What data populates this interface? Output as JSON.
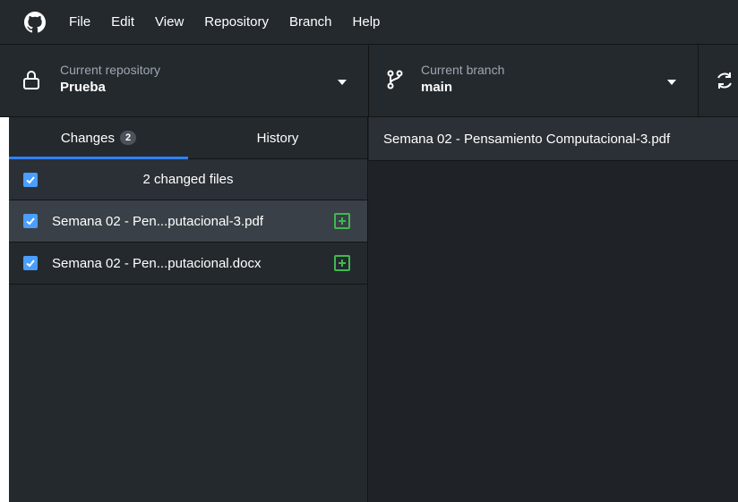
{
  "menubar": {
    "logo_icon": "github-icon",
    "items": [
      "File",
      "Edit",
      "View",
      "Repository",
      "Branch",
      "Help"
    ]
  },
  "toolbar": {
    "repository": {
      "label": "Current repository",
      "value": "Prueba",
      "icon": "lock-icon"
    },
    "branch": {
      "label": "Current branch",
      "value": "main",
      "icon": "branch-icon"
    },
    "fetch": {
      "icon": "sync-icon"
    }
  },
  "sidebar": {
    "tabs": [
      {
        "label": "Changes",
        "count": "2",
        "active": true
      },
      {
        "label": "History",
        "active": false
      }
    ],
    "changed_files_header": "2 changed files",
    "files": [
      {
        "name": "Semana 02 - Pen...putacional-3.pdf",
        "status": "added",
        "checked": true,
        "selected": true
      },
      {
        "name": "Semana 02 - Pen...putacional.docx",
        "status": "added",
        "checked": true,
        "selected": false
      }
    ]
  },
  "diff": {
    "header": "Semana 02 - Pensamiento Computacional-3.pdf"
  },
  "colors": {
    "accent": "#2f81f7",
    "checkbox": "#4a9eff",
    "added": "#3fb950",
    "background": "#24292e"
  }
}
